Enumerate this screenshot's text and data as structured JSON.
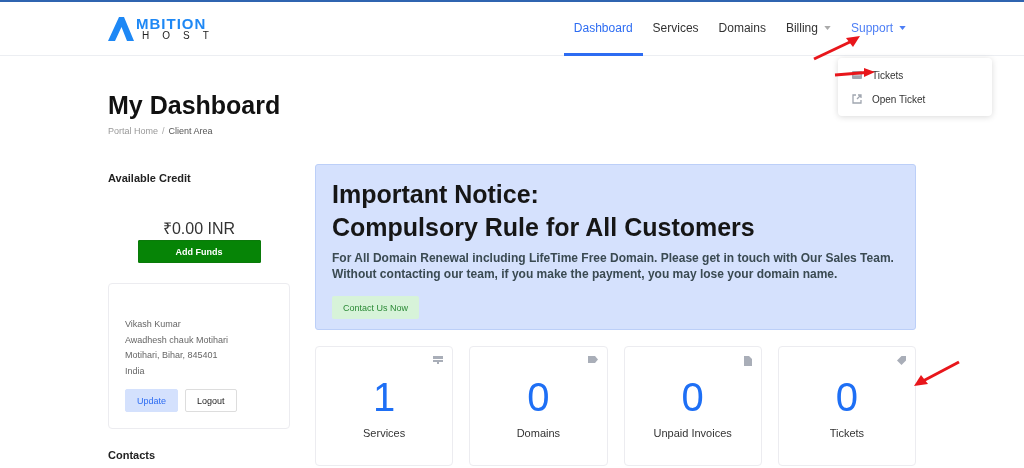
{
  "logo": {
    "wordmark": "MBITION",
    "subline": "HOST"
  },
  "nav": [
    {
      "label": "Dashboard",
      "selected": true,
      "dropdown": false,
      "open": false
    },
    {
      "label": "Services",
      "selected": false,
      "dropdown": false,
      "open": false
    },
    {
      "label": "Domains",
      "selected": false,
      "dropdown": false,
      "open": false
    },
    {
      "label": "Billing",
      "selected": false,
      "dropdown": true,
      "open": false
    },
    {
      "label": "Support",
      "selected": false,
      "dropdown": true,
      "open": true
    }
  ],
  "support_menu": [
    {
      "label": "Tickets",
      "kind": "inbox"
    },
    {
      "label": "Open Ticket",
      "kind": "external"
    }
  ],
  "page_title": "My Dashboard",
  "breadcrumb_separator": "/",
  "breadcrumb": [
    {
      "label": "Portal Home",
      "current": false
    },
    {
      "label": "Client Area",
      "current": true
    }
  ],
  "credit": {
    "heading": "Available Credit",
    "amount": "₹0.00 INR",
    "button": "Add Funds"
  },
  "address": {
    "lines": [
      "Vikash Kumar",
      "Awadhesh chauk Motihari",
      "Motihari, Bihar, 845401",
      "India"
    ],
    "buttons": [
      {
        "label": "Update",
        "kind": "primary"
      },
      {
        "label": "Logout",
        "kind": "outline"
      }
    ]
  },
  "contacts_heading": "Contacts",
  "notice": {
    "title_lines": [
      "Important Notice:",
      "Compulsory Rule for All Customers"
    ],
    "text_lines": [
      "For All Domain Renewal including LifeTime Free Domain. Please get in touch with Our Sales Team.",
      "Without contacting our team, if you make the payment, you may lose your domain name."
    ],
    "button": "Contact Us Now"
  },
  "stats": [
    {
      "value": "1",
      "label": "Services",
      "kind": "server"
    },
    {
      "value": "0",
      "label": "Domains",
      "kind": "label"
    },
    {
      "value": "0",
      "label": "Unpaid Invoices",
      "kind": "file"
    },
    {
      "value": "0",
      "label": "Tickets",
      "kind": "tag"
    }
  ]
}
